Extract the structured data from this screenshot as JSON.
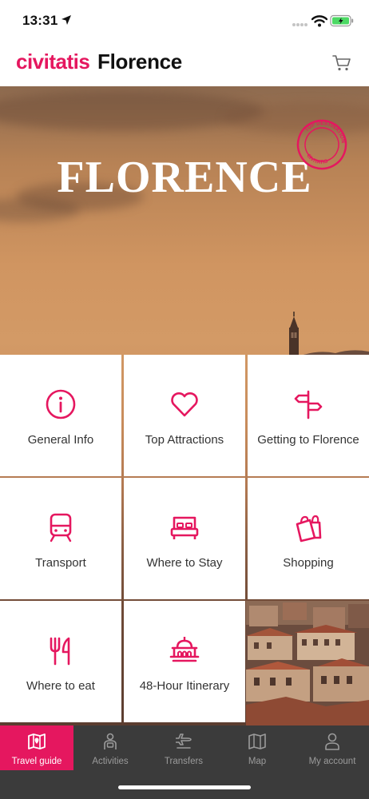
{
  "status_bar": {
    "time": "13:31"
  },
  "header": {
    "brand": "civitatis",
    "city": "Florence"
  },
  "hero": {
    "title": "FLORENCE",
    "stamp_top": "TOP DESTINATION",
    "stamp_bottom": "CIVITATIS"
  },
  "tiles": [
    {
      "label": "General Info",
      "icon": "info-icon"
    },
    {
      "label": "Top Attractions",
      "icon": "heart-icon"
    },
    {
      "label": "Getting to Florence",
      "icon": "signpost-icon"
    },
    {
      "label": "Transport",
      "icon": "train-icon"
    },
    {
      "label": "Where to Stay",
      "icon": "bed-icon"
    },
    {
      "label": "Shopping",
      "icon": "shopping-bags-icon"
    },
    {
      "label": "Where to eat",
      "icon": "fork-knife-icon"
    },
    {
      "label": "48-Hour Itinerary",
      "icon": "monument-icon"
    }
  ],
  "bottom_nav": [
    {
      "label": "Travel guide",
      "icon": "map-book-icon",
      "active": true
    },
    {
      "label": "Activities",
      "icon": "guide-person-icon",
      "active": false
    },
    {
      "label": "Transfers",
      "icon": "plane-icon",
      "active": false
    },
    {
      "label": "Map",
      "icon": "map-icon",
      "active": false
    },
    {
      "label": "My account",
      "icon": "user-icon",
      "active": false
    }
  ],
  "colors": {
    "accent": "#e5175f",
    "nav_bg": "#3b3b3b",
    "nav_text": "#9b9b9b"
  }
}
